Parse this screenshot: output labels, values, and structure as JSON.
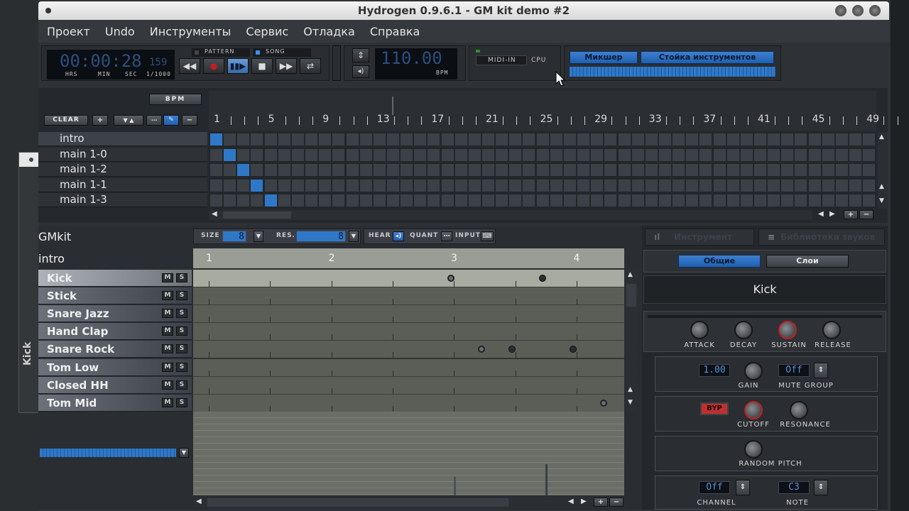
{
  "window": {
    "title": "Hydrogen 0.9.6.1 - GM kit demo #2"
  },
  "menu": [
    "Проект",
    "Undo",
    "Инструменты",
    "Сервис",
    "Отладка",
    "Справка"
  ],
  "transport": {
    "time_hours_min_sec": "00:00:28",
    "time_ms": "159",
    "time_labels": [
      "HRS",
      "MIN",
      "SEC",
      "1/1000"
    ],
    "mode_pattern": "PATTERN",
    "mode_song": "SONG",
    "bpm_value": "110.00",
    "bpm_label": "BPM",
    "midi_in": "MIDI-IN",
    "cpu": "CPU",
    "mixer_button": "Микшер",
    "rack_button": "Стойка инструментов"
  },
  "song_editor": {
    "bpm_button": "BPM",
    "clear_button": "CLEAR",
    "ruler_ticks": [
      "1",
      "5",
      "9",
      "13",
      "17",
      "21",
      "25",
      "29",
      "33",
      "37",
      "41",
      "45",
      "49"
    ],
    "patterns": [
      "intro",
      "main 1-0",
      "main 1-2",
      "main 1-1",
      "main 1-3"
    ],
    "active_cells": [
      [
        0,
        0
      ],
      [
        1,
        1
      ],
      [
        2,
        2
      ],
      [
        3,
        3
      ],
      [
        4,
        4
      ]
    ]
  },
  "pattern_editor": {
    "drumkit": "GMkit",
    "pattern_name": "intro",
    "size_label": "SIZE",
    "size_value": "8",
    "res_label": "RES.",
    "res_value": "8",
    "hear_label": "HEAR",
    "quant_label": "QUANT",
    "input_label": "INPUT",
    "beats": [
      "1",
      "2",
      "3",
      "4"
    ],
    "instruments": [
      "Kick",
      "Stick",
      "Snare Jazz",
      "Hand Clap",
      "Snare Rock",
      "Tom Low",
      "Closed HH",
      "Tom Mid"
    ],
    "mute_label": "M",
    "solo_label": "S"
  },
  "right_panel": {
    "tab_instrument": "Инструмент",
    "tab_sound_library": "Библиотека звуков",
    "tab_general": "Общие",
    "tab_layers": "Слои",
    "instrument_name": "Kick",
    "attack": "ATTACK",
    "decay": "DECAY",
    "sustain": "SUSTAIN",
    "release": "RELEASE",
    "gain_value": "1.00",
    "gain": "GAIN",
    "mute_group_value": "Off",
    "mute_group": "MUTE GROUP",
    "bypass": "BYP",
    "cutoff": "CUTOFF",
    "resonance": "RESONANCE",
    "random_pitch": "RANDOM PITCH",
    "channel_value": "Off",
    "channel": "CHANNEL",
    "note_value": "C3",
    "note": "NOTE"
  },
  "background_window": {
    "vertical_label": "Kick"
  }
}
